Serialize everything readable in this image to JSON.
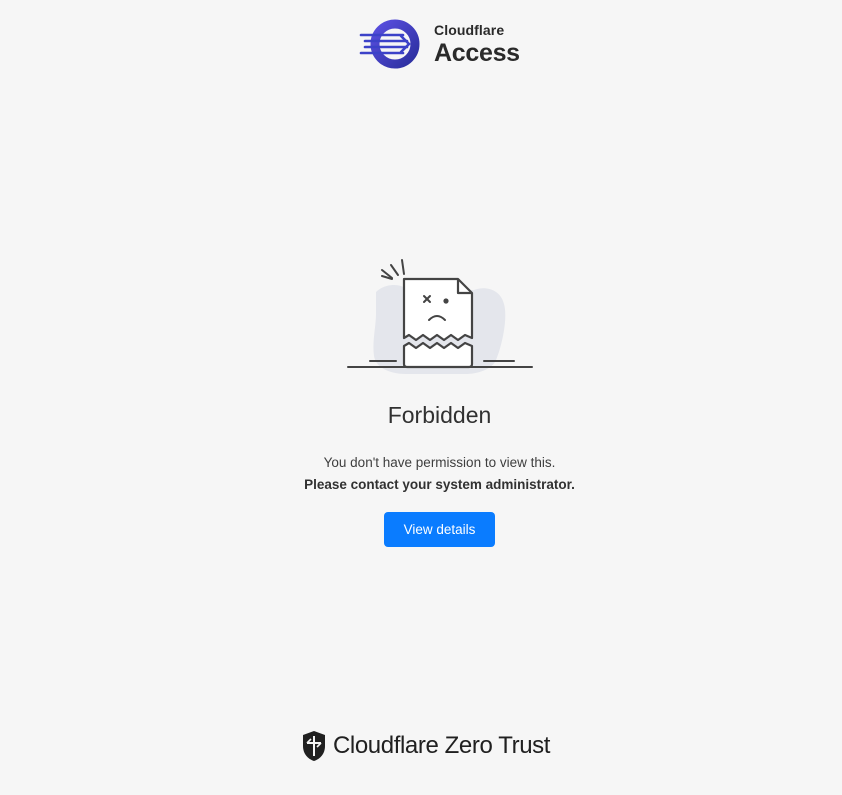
{
  "header": {
    "logo_icon": "cloudflare-access-arrow-icon",
    "brand": "Cloudflare",
    "product": "Access"
  },
  "main": {
    "illustration_icon": "broken-document-icon",
    "title": "Forbidden",
    "message": "You don't have permission to view this.",
    "instruction": "Please contact your system administrator.",
    "button_label": "View details"
  },
  "footer": {
    "shield_icon": "cloudflare-shield-icon",
    "brand_text": "Cloudflare Zero Trust"
  },
  "colors": {
    "background": "#f6f6f6",
    "accent_button": "#0a7cff",
    "logo_ring": "#3b3fc4",
    "text": "#313131"
  }
}
